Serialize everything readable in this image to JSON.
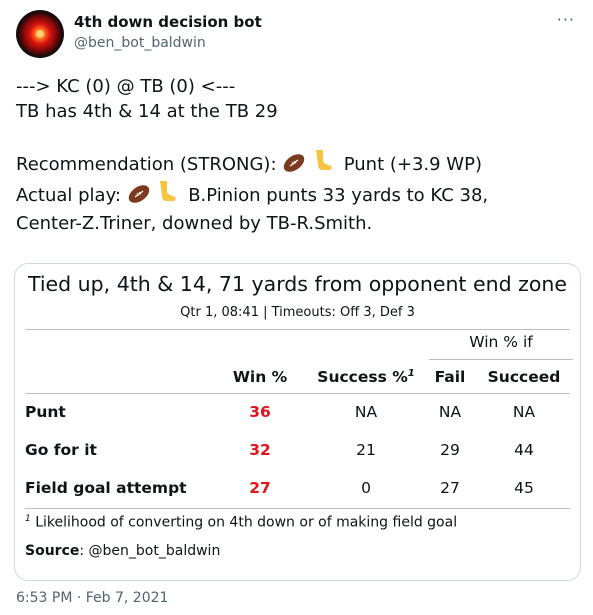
{
  "tweet": {
    "author_name": "4th down decision bot",
    "author_handle": "@ben_bot_baldwin",
    "more_icon": "···",
    "line1": "---> KC (0) @ TB (0) <---",
    "line2": "TB has 4th & 14 at the TB 29",
    "rec_prefix": "Recommendation (STRONG):",
    "rec_text": "Punt (+3.9 WP)",
    "actual_prefix": "Actual play:",
    "actual_text": "B.Pinion punts 33 yards to KC 38,",
    "actual_text2": "Center-Z.Triner, downed by TB-R.Smith.",
    "timestamp": "6:53 PM · Feb 7, 2021"
  },
  "card": {
    "title": "Tied up, 4th & 14, 71 yards from opponent end zone",
    "subtitle": "Qtr 1, 08:41 | Timeouts: Off 3, Def 3",
    "group_header": "Win % if",
    "columns": {
      "win": "Win %",
      "success": "Success %",
      "success_sup": "1",
      "fail": "Fail",
      "succeed": "Succeed"
    },
    "rows": [
      {
        "label": "Punt",
        "win": "36",
        "success": "NA",
        "fail": "NA",
        "succeed": "NA"
      },
      {
        "label": "Go for it",
        "win": "32",
        "success": "21",
        "fail": "29",
        "succeed": "44"
      },
      {
        "label": "Field goal attempt",
        "win": "27",
        "success": "0",
        "fail": "27",
        "succeed": "45"
      }
    ],
    "footnote_mark": "1",
    "footnote": "Likelihood of converting on 4th down or of making field goal",
    "source_label": "Source",
    "source_value": ": @ben_bot_baldwin"
  },
  "colors": {
    "win_pct": "#e0151b",
    "secondary_text": "#536471",
    "border": "#cfd9de"
  }
}
